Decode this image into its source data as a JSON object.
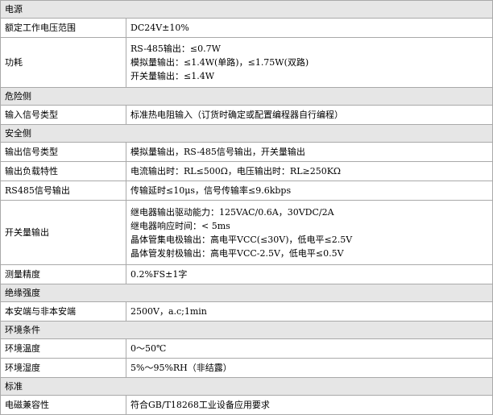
{
  "rows": [
    {
      "type": "section",
      "label": "电源"
    },
    {
      "type": "row",
      "label": "额定工作电压范围",
      "values": [
        "DC24V±10%"
      ]
    },
    {
      "type": "row",
      "label": "功耗",
      "values": [
        "RS-485输出：≤0.7W",
        "模拟量输出：≤1.4W(单路)，≤1.75W(双路)",
        "开关量输出：≤1.4W"
      ]
    },
    {
      "type": "section",
      "label": "危险侧"
    },
    {
      "type": "row",
      "label": "输入信号类型",
      "values": [
        "标准热电阻输入（订货时确定或配置编程器自行编程）"
      ]
    },
    {
      "type": "section",
      "label": "安全侧"
    },
    {
      "type": "row",
      "label": "输出信号类型",
      "values": [
        "模拟量输出，RS-485信号输出，开关量输出"
      ]
    },
    {
      "type": "row",
      "label": "输出负载特性",
      "values": [
        "电流输出时：RL≤500Ω，电压输出时：RL≥250KΩ"
      ]
    },
    {
      "type": "row",
      "label": "RS485信号输出",
      "values": [
        "传输延时≤10μs，信号传输率≤9.6kbps"
      ]
    },
    {
      "type": "row",
      "label": "开关量输出",
      "values": [
        "继电器输出驱动能力：125VAC/0.6A，30VDC/2A",
        "继电器响应时间：< 5ms",
        "晶体管集电极输出：高电平VCC(≤30V)，低电平≤2.5V",
        "晶体管发射极输出：高电平VCC-2.5V，低电平≤0.5V"
      ]
    },
    {
      "type": "row",
      "label": "测量精度",
      "values": [
        "0.2%FS±1字"
      ]
    },
    {
      "type": "section",
      "label": "绝缘强度"
    },
    {
      "type": "row",
      "label": "本安端与非本安端",
      "values": [
        "2500V，a.c;1min"
      ]
    },
    {
      "type": "section",
      "label": "环境条件"
    },
    {
      "type": "row",
      "label": "环境温度",
      "values": [
        "0～50℃"
      ]
    },
    {
      "type": "row",
      "label": "环境湿度",
      "values": [
        "5%～95%RH（非结露）"
      ]
    },
    {
      "type": "section",
      "label": "标准"
    },
    {
      "type": "row",
      "label": "电磁兼容性",
      "values": [
        "符合GB/T18268工业设备应用要求"
      ]
    }
  ]
}
